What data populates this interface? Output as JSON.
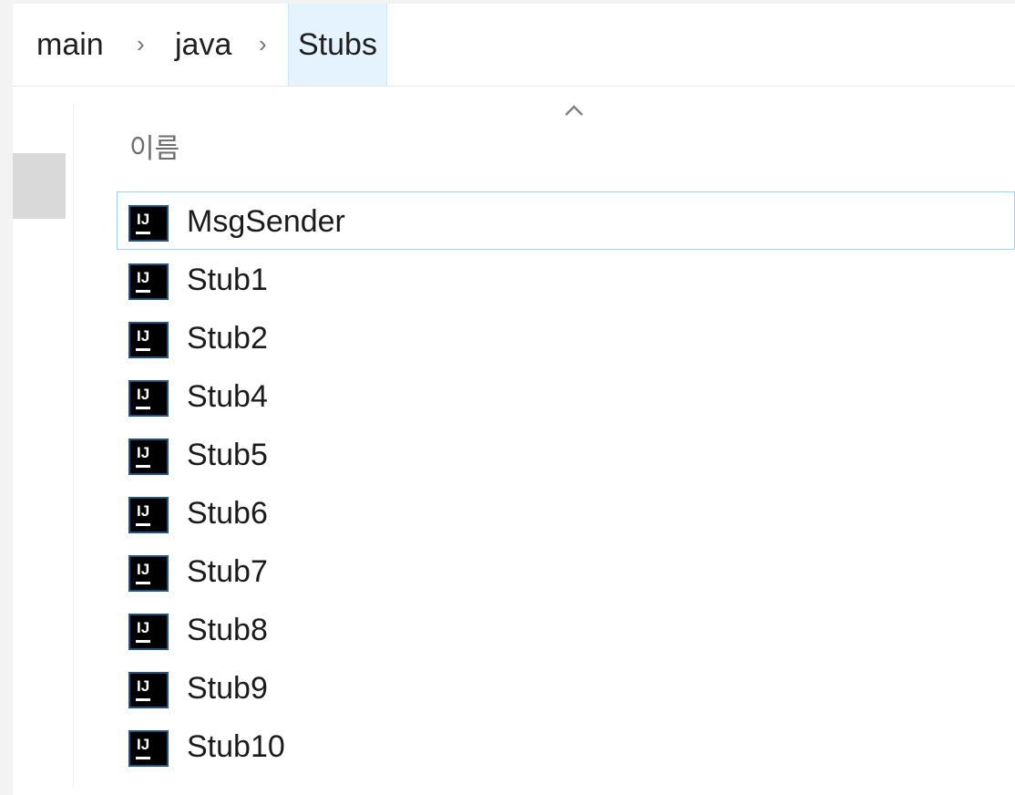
{
  "breadcrumb": {
    "items": [
      "main",
      "java",
      "Stubs"
    ],
    "separator": "›"
  },
  "columns": {
    "name_label": "이름",
    "sort_indicator": "ascending"
  },
  "files": [
    {
      "name": "MsgSender",
      "icon": "intellij-java-file-icon",
      "focused": true
    },
    {
      "name": "Stub1",
      "icon": "intellij-java-file-icon"
    },
    {
      "name": "Stub2",
      "icon": "intellij-java-file-icon"
    },
    {
      "name": "Stub4",
      "icon": "intellij-java-file-icon"
    },
    {
      "name": "Stub5",
      "icon": "intellij-java-file-icon"
    },
    {
      "name": "Stub6",
      "icon": "intellij-java-file-icon"
    },
    {
      "name": "Stub7",
      "icon": "intellij-java-file-icon"
    },
    {
      "name": "Stub8",
      "icon": "intellij-java-file-icon"
    },
    {
      "name": "Stub9",
      "icon": "intellij-java-file-icon"
    },
    {
      "name": "Stub10",
      "icon": "intellij-java-file-icon"
    }
  ],
  "colors": {
    "selection_border": "#99d1ff",
    "current_crumb_bg": "#e5f3ff",
    "icon_bg": "#000000",
    "icon_fg": "#ffffff"
  }
}
